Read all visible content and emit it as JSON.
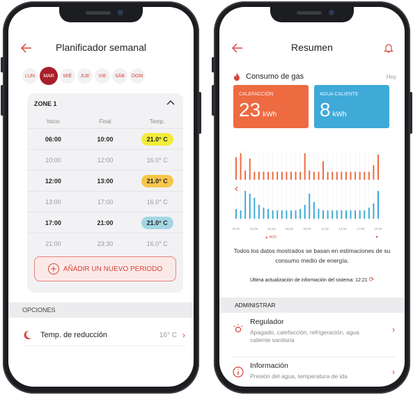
{
  "left": {
    "title": "Planificador semanal",
    "days": [
      "LUN",
      "MAR",
      "MIÉ",
      "JUE",
      "VIE",
      "SÁB",
      "DOM"
    ],
    "active_day": "MAR",
    "zone_title": "ZONE 1",
    "headers": [
      "Inicio",
      "Final",
      "Temp."
    ],
    "rows": [
      {
        "start": "06:00",
        "end": "10:00",
        "temp": "21.0° C",
        "bold": true,
        "color": "#f2ec3a"
      },
      {
        "start": "10:00",
        "end": "12:00",
        "temp": "16.0° C",
        "bold": false
      },
      {
        "start": "12:00",
        "end": "13:00",
        "temp": "21.0° C",
        "bold": true,
        "color": "#f6c64a"
      },
      {
        "start": "13:00",
        "end": "17:00",
        "temp": "16.0° C",
        "bold": false
      },
      {
        "start": "17:00",
        "end": "21:00",
        "temp": "21.0° C",
        "bold": true,
        "color": "#a3d6e4"
      },
      {
        "start": "21:00",
        "end": "23:30",
        "temp": "16.0° C",
        "bold": false
      }
    ],
    "add_button": "AÑADIR UN NUEVO PERIODO",
    "options_header": "OPCIONES",
    "option_label": "Temp. de reducción",
    "option_value": "16° C"
  },
  "right": {
    "title": "Resumen",
    "consumo_label": "Consumo de gas",
    "hoy": "Hoy",
    "card1": {
      "label": "CALEFACCIÓN",
      "value": "23",
      "unit": "kWh",
      "color": "#ee6a40"
    },
    "card2": {
      "label": "AGUA CALIENTE",
      "value": "8",
      "unit": "kWh",
      "color": "#3fa9d8"
    },
    "note": "Todos los datos mostrados se basan en estimaciones de su consumo medio de energía.",
    "update": "Última actualización de información del sistema: 12:21",
    "admin_header": "ADMINISTRAR",
    "items": [
      {
        "title": "Regulador",
        "desc": "Apagado, calefacción, refrigeración, agua caliente sanitaria"
      },
      {
        "title": "Información",
        "desc": "Presión del agua, temperatura de ida"
      }
    ]
  },
  "chart_data": {
    "type": "bar",
    "x_ticks": [
      "20:00",
      "23:00",
      "02:00",
      "05:00",
      "08:00",
      "11:00",
      "14:00",
      "17:00",
      "20:00"
    ],
    "hoy_label": "HOY",
    "series": [
      {
        "color": "#ee6a40",
        "values": [
          0.85,
          1,
          0.35,
          0.8,
          0.3,
          0.3,
          0.3,
          0.3,
          0.3,
          0.3,
          0.3,
          0.3,
          0.3,
          0.3,
          0.3,
          1,
          0.35,
          0.3,
          0.3,
          0.7,
          0.3,
          0.3,
          0.3,
          0.3,
          0.3,
          0.3,
          0.3,
          0.3,
          0.3,
          0.3,
          0.55,
          0.95
        ]
      },
      {
        "color": "#3fa9d8",
        "values": [
          0.35,
          0.3,
          1,
          0.9,
          0.75,
          0.5,
          0.4,
          0.35,
          0.3,
          0.3,
          0.3,
          0.3,
          0.3,
          0.3,
          0.35,
          0.5,
          0.9,
          0.6,
          0.35,
          0.3,
          0.3,
          0.3,
          0.3,
          0.3,
          0.3,
          0.3,
          0.3,
          0.3,
          0.3,
          0.4,
          0.55,
          1
        ]
      }
    ]
  }
}
